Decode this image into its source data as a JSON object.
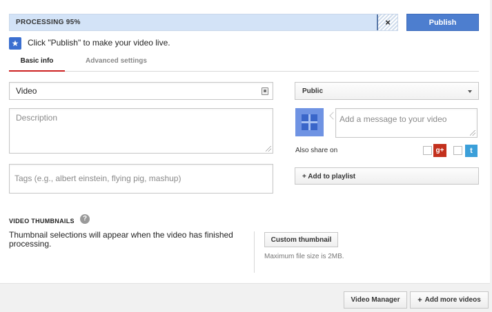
{
  "progress": {
    "label": "PROCESSING 95%",
    "percent": 95,
    "close_icon": "close-icon",
    "close_glyph": "×"
  },
  "publish": {
    "label": "Publish",
    "color": "#4d7ecf"
  },
  "hint": {
    "text": "Click \"Publish\" to make your video live.",
    "icon": "star-icon",
    "glyph": "★"
  },
  "tabs": [
    {
      "label": "Basic info",
      "active": true
    },
    {
      "label": "Advanced settings",
      "active": false
    }
  ],
  "form": {
    "title_value": "Video",
    "description_placeholder": "Description",
    "tags_placeholder": "Tags (e.g., albert einstein, flying pig, mashup)"
  },
  "right": {
    "privacy_value": "Public",
    "message_placeholder": "Add a message to your video",
    "also_share_label": "Also share on",
    "google_glyph": "g+",
    "twitter_glyph": "t",
    "add_to_playlist_label": "+ Add to playlist"
  },
  "thumbnails": {
    "section_title": "VIDEO THUMBNAILS",
    "help_glyph": "?",
    "message": "Thumbnail selections will appear when the video has finished processing.",
    "custom_button_label": "Custom thumbnail",
    "max_size_text": "Maximum file size is 2MB."
  },
  "footer": {
    "video_manager_label": "Video Manager",
    "add_more_plus": "+",
    "add_more_label": "Add more videos"
  },
  "colors": {
    "accent_red": "#cc1f1f",
    "progress_fill": "#d3e3f7",
    "google_plus": "#c3301d",
    "twitter": "#3b9fd9"
  }
}
